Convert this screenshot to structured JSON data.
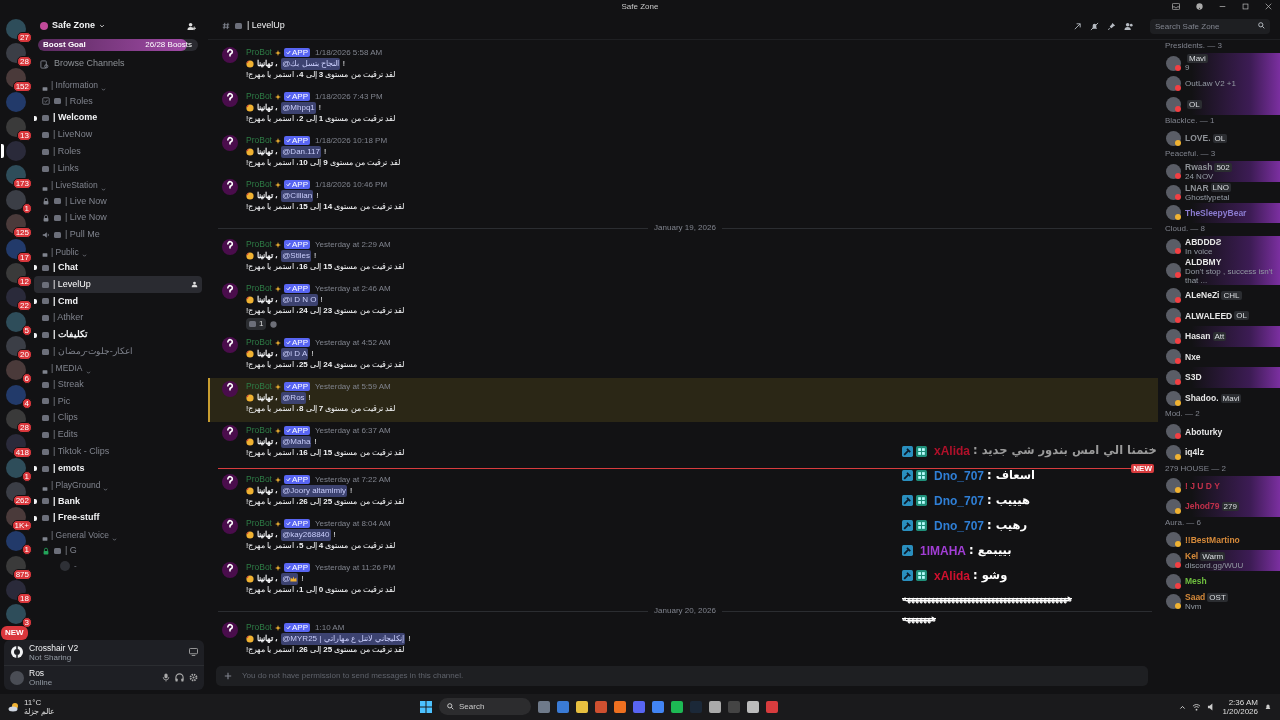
{
  "window": {
    "title": "Safe Zone"
  },
  "servers": [
    {
      "badge": "27",
      "selected": false
    },
    {
      "badge": "28",
      "selected": false
    },
    {
      "badge": "152",
      "selected": false
    },
    {
      "selected": false
    },
    {
      "badge": "13",
      "selected": false
    },
    {
      "selected": true
    },
    {
      "badge": "173",
      "selected": false
    },
    {
      "badge": "1",
      "selected": false
    },
    {
      "badge": "125",
      "selected": false
    },
    {
      "badge": "17",
      "selected": false
    },
    {
      "badge": "12",
      "selected": false
    },
    {
      "badge": "22",
      "selected": false
    },
    {
      "badge": "5",
      "selected": false
    },
    {
      "badge": "20",
      "selected": false
    },
    {
      "badge": "6",
      "selected": false
    },
    {
      "badge": "4",
      "selected": false
    },
    {
      "badge": "28",
      "selected": false
    },
    {
      "badge": "418",
      "selected": false
    },
    {
      "badge": "1",
      "selected": false
    },
    {
      "badge": "262",
      "selected": false
    },
    {
      "badge": "1K+",
      "selected": false
    },
    {
      "badge": "1",
      "selected": false
    },
    {
      "badge": "875",
      "selected": false
    },
    {
      "badge": "18",
      "selected": false
    },
    {
      "badge": "3",
      "selected": false
    }
  ],
  "new_pill": "NEW",
  "server_name": "Safe Zone",
  "boost": {
    "label": "Boost Goal",
    "count": "26/28 Boosts",
    "level": 0.93
  },
  "browse": "Browse Channels",
  "categories": [
    {
      "name": "| Information",
      "channels": [
        {
          "kind": "rules",
          "name": "| Roles",
          "unread": false,
          "selected": false
        },
        {
          "kind": "text",
          "name": "| Welcome",
          "unread": true,
          "selected": false
        },
        {
          "kind": "text",
          "name": "| LiveNow",
          "unread": false,
          "selected": false
        },
        {
          "kind": "text",
          "name": "| Roles",
          "unread": false,
          "selected": false
        },
        {
          "kind": "text",
          "name": "| Links",
          "unread": false,
          "selected": false
        }
      ]
    },
    {
      "name": "| LiveStation",
      "channels": [
        {
          "kind": "locked",
          "name": "| Live Now",
          "unread": false,
          "selected": false
        },
        {
          "kind": "locked",
          "name": "| Live Now",
          "unread": false,
          "selected": false
        },
        {
          "kind": "voice",
          "name": "| Pull Me",
          "unread": false,
          "selected": false
        }
      ]
    },
    {
      "name": "| Public",
      "channels": [
        {
          "kind": "text",
          "name": "| Chat",
          "unread": true,
          "selected": false
        },
        {
          "kind": "text",
          "name": "| LevelUp",
          "unread": false,
          "selected": true
        },
        {
          "kind": "text",
          "name": "| Cmd",
          "unread": true,
          "selected": false
        },
        {
          "kind": "text",
          "name": "| Athker",
          "unread": false,
          "selected": false
        },
        {
          "kind": "text",
          "name": "| تكليفات",
          "unread": true,
          "selected": false
        },
        {
          "kind": "text",
          "name": "| اعكار-جلوت-رمضان",
          "unread": false,
          "selected": false
        }
      ]
    },
    {
      "name": "| MEDIA",
      "channels": [
        {
          "kind": "text",
          "name": "| Streak",
          "unread": false,
          "selected": false
        },
        {
          "kind": "text",
          "name": "| Pic",
          "unread": false,
          "selected": false
        },
        {
          "kind": "text",
          "name": "| Clips",
          "unread": false,
          "selected": false
        },
        {
          "kind": "text",
          "name": "| Edits",
          "unread": false,
          "selected": false
        },
        {
          "kind": "text",
          "name": "| Tiktok - Clips",
          "unread": false,
          "selected": false
        },
        {
          "kind": "text",
          "name": "| emots",
          "unread": true,
          "selected": false
        }
      ]
    },
    {
      "name": "| PlayGround",
      "channels": [
        {
          "kind": "text",
          "name": "| Bank",
          "unread": true,
          "selected": false
        },
        {
          "kind": "text",
          "name": "| Free-stuff",
          "unread": true,
          "selected": false
        }
      ]
    },
    {
      "name": "| General Voice",
      "channels": [
        {
          "kind": "joined_lock",
          "name": "| G",
          "unread": false,
          "selected": false,
          "voice_members": [
            "-"
          ]
        }
      ]
    }
  ],
  "stream": {
    "name": "Crosshair V2",
    "status": "Not Sharing"
  },
  "user": {
    "name": "Ros",
    "status": "Online"
  },
  "channel_header": {
    "name": "| LevelUp"
  },
  "search": {
    "placeholder": "Search Safe Zone"
  },
  "feed": [
    {
      "kind": "message",
      "author": "ProBot",
      "tag": "APP",
      "time": "1/18/2026 5:58 AM",
      "greeting": "تهانينا ،",
      "mention": "@النجاح بتسل بك",
      "end": "!",
      "text": "لقد ترقيت من مستوى **3** إلى **4**، استمر يا مهرج!",
      "highlighted": false
    },
    {
      "kind": "message",
      "author": "ProBot",
      "tag": "APP",
      "time": "1/18/2026 7:43 PM",
      "greeting": "تهانينا ،",
      "mention": "@Mhpq1",
      "end": "!",
      "text": "لقد ترقيت من مستوى **1** إلى **2**، استمر يا مهرج!",
      "highlighted": false
    },
    {
      "kind": "message",
      "author": "ProBot",
      "tag": "APP",
      "time": "1/18/2026 10:18 PM",
      "greeting": "تهانينا ،",
      "mention": "@Dan.117",
      "end": "!",
      "text": "لقد ترقيت من مستوى **9** إلى **10**، استمر يا مهرج!",
      "highlighted": false
    },
    {
      "kind": "message",
      "author": "ProBot",
      "tag": "APP",
      "time": "1/18/2026 10:46 PM",
      "greeting": "تهانينا ،",
      "mention": "@Cillian",
      "end": "!",
      "text": "لقد ترقيت من مستوى **14** إلى **15**، استمر يا مهرج!",
      "highlighted": false
    },
    {
      "kind": "date",
      "label": "January 19, 2026"
    },
    {
      "kind": "message",
      "author": "ProBot",
      "tag": "APP",
      "time": "Yesterday at 2:29 AM",
      "greeting": "تهانينا ،",
      "mention": "@Stiles",
      "end": "!",
      "text": "لقد ترقيت من مستوى **15** إلى **16**، استمر يا مهرج!",
      "highlighted": false
    },
    {
      "kind": "message",
      "author": "ProBot",
      "tag": "APP",
      "time": "Yesterday at 2:46 AM",
      "greeting": "تهانينا ،",
      "mention": "@i D N O",
      "end": "!",
      "text": "لقد ترقيت من مستوى **23** إلى **24**، استمر يا مهرج!",
      "highlighted": false,
      "reactions": [
        {
          "count": "1"
        }
      ]
    },
    {
      "kind": "message",
      "author": "ProBot",
      "tag": "APP",
      "time": "Yesterday at 4:52 AM",
      "greeting": "تهانينا ،",
      "mention": "@i D A",
      "end": "!",
      "text": "لقد ترقيت من مستوى **24** إلى **25**، استمر يا مهرج!",
      "highlighted": false
    },
    {
      "kind": "message",
      "author": "ProBot",
      "tag": "APP",
      "time": "Yesterday at 5:59 AM",
      "greeting": "تهانينا ،",
      "mention": "@Ros",
      "end": "!",
      "text": "لقد ترقيت من مستوى **7** إلى **8**، استمر يا مهرج!",
      "highlighted": true
    },
    {
      "kind": "message",
      "author": "ProBot",
      "tag": "APP",
      "time": "Yesterday at 6:37 AM",
      "greeting": "تهانينا ،",
      "mention": "@Maha",
      "end": "!",
      "text": "لقد ترقيت من مستوى **15** إلى **16**، استمر يا مهرج!",
      "highlighted": false
    },
    {
      "kind": "new"
    },
    {
      "kind": "message",
      "author": "ProBot",
      "tag": "APP",
      "time": "Yesterday at 7:22 AM",
      "greeting": "تهانينا ،",
      "mention": "@Joory altamimiy",
      "end": "!",
      "text": "لقد ترقيت من مستوى **25** إلى **26**، استمر يا مهرج!",
      "highlighted": false
    },
    {
      "kind": "message",
      "author": "ProBot",
      "tag": "APP",
      "time": "Yesterday at 8:04 AM",
      "greeting": "تهانينا ،",
      "mention": "@kay268840",
      "end": "!",
      "text": "لقد ترقيت من مستوى **4** إلى **5**، استمر يا مهرج!",
      "highlighted": false
    },
    {
      "kind": "message",
      "author": "ProBot",
      "tag": "APP",
      "time": "Yesterday at 11:26 PM",
      "greeting": "تهانينا ،",
      "mention": "@",
      "mention_crown": true,
      "end": "!",
      "text": "لقد ترقيت من مستوى **0** إلى **1**، استمر يا مهرج!",
      "highlighted": false
    },
    {
      "kind": "date",
      "label": "January 20, 2026"
    },
    {
      "kind": "message",
      "author": "ProBot",
      "tag": "APP",
      "time": "1:10 AM",
      "greeting": "تهانينا ،",
      "mention": "@MYR25 | إنكليجاني لاتنل ع مهاراتي",
      "end": "!",
      "text": "لقد ترقيت من مستوى **25** إلى **26**، استمر يا مهرج!",
      "highlighted": false
    }
  ],
  "new_label": "NEW",
  "composer": {
    "placeholder": "You do not have permission to send messages in this channel."
  },
  "overlay": {
    "rows": [
      {
        "user": "xAlida",
        "color": "#b0102a",
        "text": ": ختمنا الي امس بندور شي جديد",
        "badges": [
          {
            "kind": "mod"
          },
          {
            "kind": "bg"
          }
        ],
        "faded": true
      },
      {
        "user": "Dno_707",
        "color": "#2f7fd6",
        "text": ": اسعاف",
        "badges": [
          {
            "kind": "mod"
          },
          {
            "kind": "bg"
          }
        ],
        "faded": false
      },
      {
        "user": "Dno_707",
        "color": "#2f7fd6",
        "text": ": هيييب",
        "badges": [
          {
            "kind": "mod"
          },
          {
            "kind": "bg"
          }
        ],
        "faded": false
      },
      {
        "user": "Dno_707",
        "color": "#2f7fd6",
        "text": ": رهيب",
        "badges": [
          {
            "kind": "mod"
          },
          {
            "kind": "bg"
          }
        ],
        "faded": false
      },
      {
        "user": "1lMAHA",
        "color": "#a23ed6",
        "text": ": بييبمع",
        "badges": [
          {
            "kind": "mod"
          }
        ],
        "faded": false
      },
      {
        "user": "xAlida",
        "color": "#d0102e",
        "text": ": وشو",
        "badges": [
          {
            "kind": "mod"
          },
          {
            "kind": "bg"
          }
        ],
        "faded": false
      }
    ],
    "spam": [
      "هههههههههههههههههههههههههههههههههههههههههه",
      "هههههههه"
    ]
  },
  "members": [
    {
      "label": "Presidents. — 3",
      "members": [
        {
          "tag": "Mavi",
          "subtitle": "9",
          "status": {
            "kind": "dnd"
          },
          "nameplate": true
        },
        {
          "subtitle": "OutLaw V2 +1",
          "status": {
            "kind": "dnd"
          },
          "nameplate": true
        },
        {
          "tag": "OL",
          "status": {
            "kind": "dnd"
          },
          "nameplate": true
        }
      ]
    },
    {
      "label": "BlackIce. — 1",
      "members": [
        {
          "name": "LOVE.",
          "color": "#8e9297",
          "tag": "OL",
          "status": {
            "kind": "idle"
          },
          "nameplate": false
        }
      ]
    },
    {
      "label": "Peaceful. — 3",
      "members": [
        {
          "name": "Rwash",
          "color": "#8e9297",
          "tag": "502",
          "subtitle": "24 NOV",
          "status": {
            "kind": "dnd"
          },
          "nameplate": true
        },
        {
          "name": "LNAR",
          "color": "#8e9297",
          "tag": "LNO",
          "subtitle": "Ghostlypetal",
          "status": {
            "kind": "dnd"
          },
          "nameplate": false
        },
        {
          "name": "TheSleepyBear",
          "color": "#8b7bd0",
          "status": {
            "kind": "idle"
          },
          "nameplate": true
        }
      ]
    },
    {
      "label": "Cloud. — 8",
      "members": [
        {
          "name": "ABDDDƧ",
          "color": "#e6e6e6",
          "subtitle": "In voice",
          "status": {
            "kind": "dnd"
          },
          "nameplate": true
        },
        {
          "name": "ALDBMY",
          "color": "#e6e6e6",
          "subtitle": "Don't stop , success isn't that ...",
          "status": {
            "kind": "dnd"
          },
          "nameplate": true
        },
        {
          "name": "ALeNeZi",
          "color": "#e6e6e6",
          "tag": "CHL",
          "status": {
            "kind": "dnd"
          },
          "nameplate": false
        },
        {
          "name": "ALWALEED",
          "color": "#e6e6e6",
          "tag": "OL",
          "status": {
            "kind": "dnd"
          },
          "nameplate": false
        },
        {
          "name": "Hasan",
          "color": "#e6e6e6",
          "tag": "Att",
          "status": {
            "kind": "dnd"
          },
          "nameplate": true
        },
        {
          "name": "Nxe",
          "color": "#e6e6e6",
          "status": {
            "kind": "dnd"
          },
          "nameplate": false
        },
        {
          "name": "S3D",
          "color": "#e6e6e6",
          "status": {
            "kind": "dnd"
          },
          "nameplate": true
        },
        {
          "name": "Shadoo.",
          "color": "#e6e6e6",
          "tag": "Mavi",
          "status": {
            "kind": "idle"
          },
          "nameplate": false
        }
      ]
    },
    {
      "label": "Mod. — 2",
      "members": [
        {
          "name": "Aboturky",
          "color": "#e6e6e6",
          "status": {
            "kind": "dnd"
          },
          "nameplate": false
        },
        {
          "name": "iq4lz",
          "color": "#e6e6e6",
          "status": {
            "kind": "idle"
          },
          "nameplate": false
        }
      ]
    },
    {
      "label": "279 HOUSE — 2",
      "members": [
        {
          "name": "! J U D Y",
          "color": "#c0304a",
          "status": {
            "kind": "idle"
          },
          "nameplate": true
        },
        {
          "name": "Jehod79",
          "color": "#c0304a",
          "tag": "279",
          "status": {
            "kind": "idle"
          },
          "nameplate": true
        }
      ]
    },
    {
      "label": "Aura. — 6",
      "members": [
        {
          "name": "!!BestMartino",
          "color": "#d68a3a",
          "status": {
            "kind": "idle"
          },
          "nameplate": false
        },
        {
          "name": "Kel",
          "color": "#d68a3a",
          "tag": "Warm",
          "subtitle": "discord.gg/WUU",
          "status": {
            "kind": "dnd"
          },
          "nameplate": true
        },
        {
          "name": "Mesh",
          "color": "#6fbf3f",
          "status": {
            "kind": "dnd"
          },
          "nameplate": false
        },
        {
          "name": "Saad",
          "color": "#d68a3a",
          "tag": "OST",
          "subtitle": "Nvm",
          "status": {
            "kind": "idle"
          },
          "nameplate": false
        }
      ]
    }
  ],
  "taskbar": {
    "temperature": "11°C",
    "weather": "عالم جزلة",
    "search": "Search",
    "time": "2:36 AM",
    "date": "1/20/2026"
  }
}
